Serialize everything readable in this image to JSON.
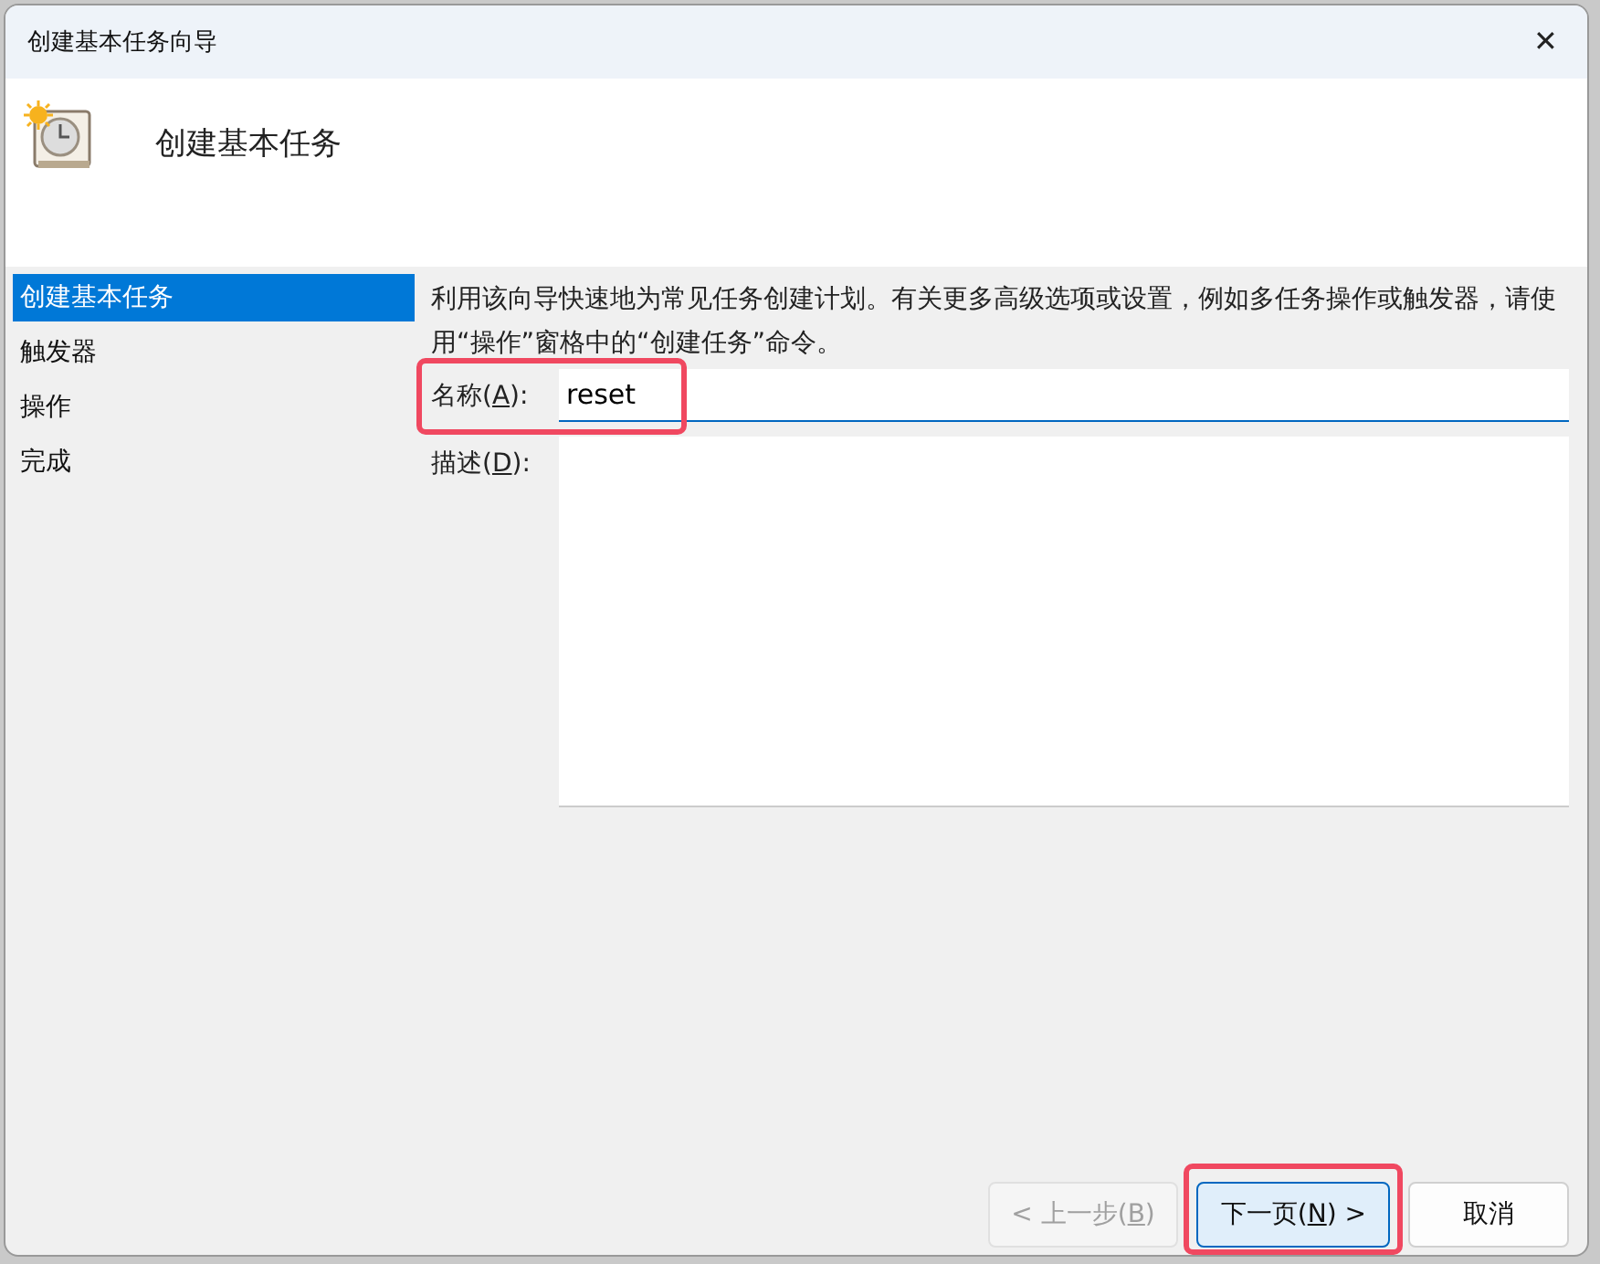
{
  "window": {
    "title": "创建基本任务向导",
    "close": "✕"
  },
  "header": {
    "title": "创建基本任务"
  },
  "sidebar": {
    "items": [
      {
        "label": "创建基本任务",
        "selected": true
      },
      {
        "label": "触发器",
        "selected": false
      },
      {
        "label": "操作",
        "selected": false
      },
      {
        "label": "完成",
        "selected": false
      }
    ]
  },
  "intro": "利用该向导快速地为常见任务创建计划。有关更多高级选项或设置，例如多任务操作或触发器，请使用“操作”窗格中的“创建任务”命令。",
  "name_field": {
    "label": {
      "before": "名称(",
      "access_key": "A",
      "after": "):"
    },
    "value": "reset",
    "highlighted": true
  },
  "description_field": {
    "label": {
      "before": "描述(",
      "access_key": "D",
      "after": "):"
    }
  },
  "buttons": [
    {
      "label": {
        "before": "< 上一步(",
        "access_key": "B",
        "after": ")"
      },
      "kind": "back",
      "disabled": true,
      "highlighted": false
    },
    {
      "label": {
        "before": "下一页(",
        "access_key": "N",
        "after": ") >"
      },
      "kind": "next",
      "disabled": false,
      "highlighted": true
    },
    {
      "label": {
        "before": "取消"
      },
      "kind": "cancel",
      "disabled": false,
      "highlighted": false
    }
  ]
}
